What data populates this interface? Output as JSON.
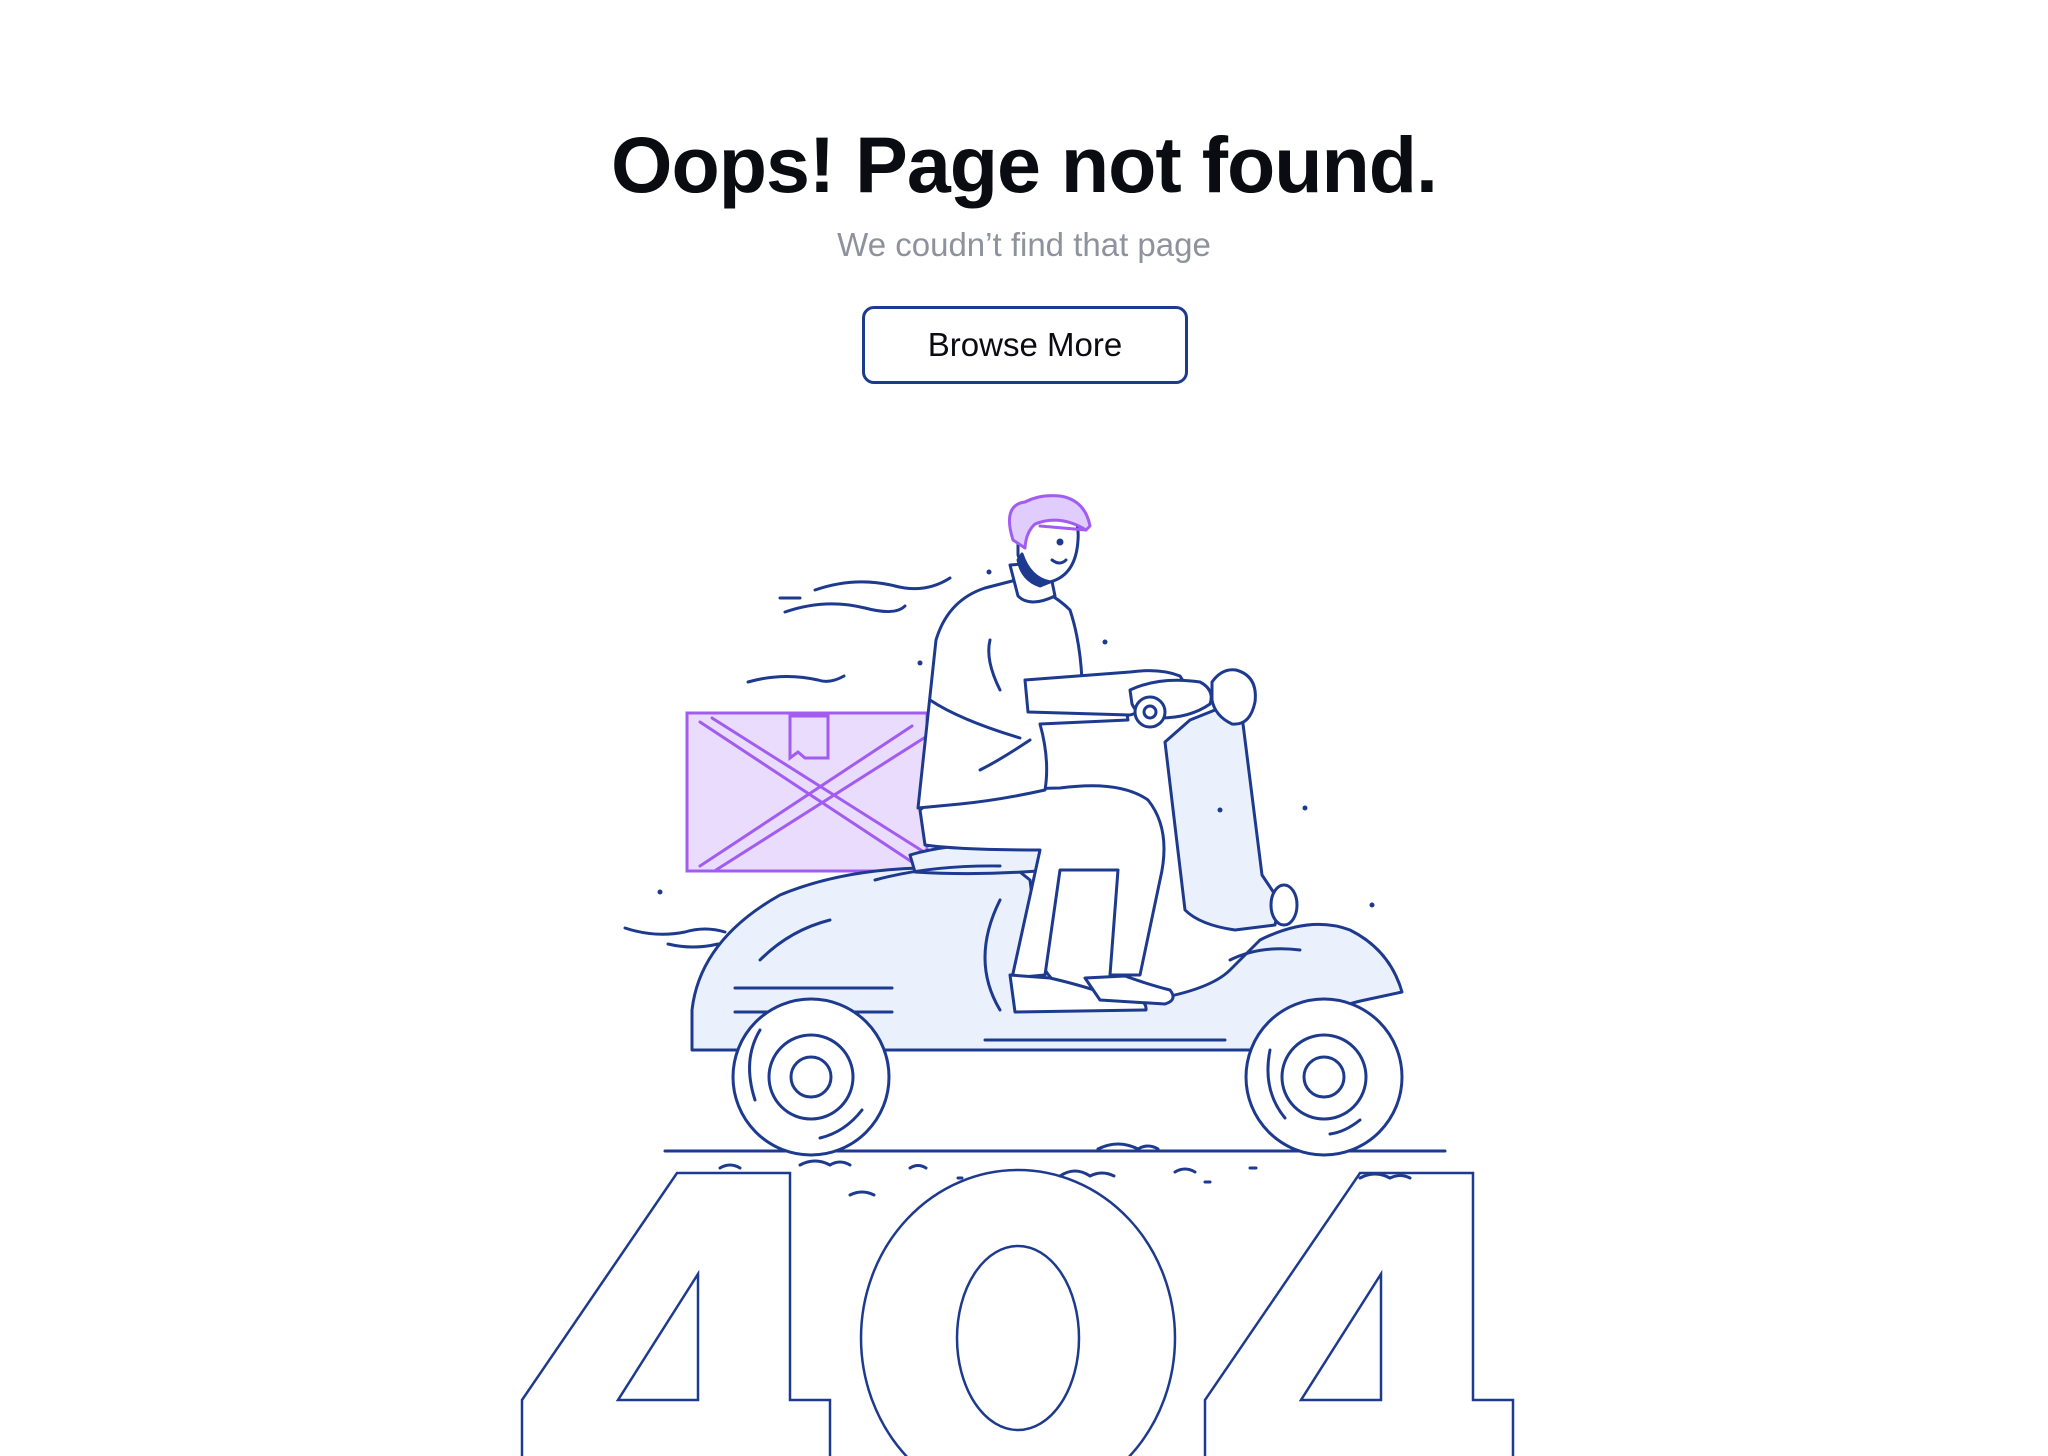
{
  "error": {
    "title": "Oops! Page not found.",
    "subtitle": "We coudn’t find that page",
    "code": "404"
  },
  "actions": {
    "browse_label": "Browse More"
  },
  "illustration": {
    "subject": "delivery-scooter-rider",
    "colors": {
      "line": "#1d3a8f",
      "fill": "#eaf0fc",
      "box_fill": "#e9dcfc",
      "box_line": "#a25cf2",
      "helmet": "#e0ccfd"
    }
  }
}
